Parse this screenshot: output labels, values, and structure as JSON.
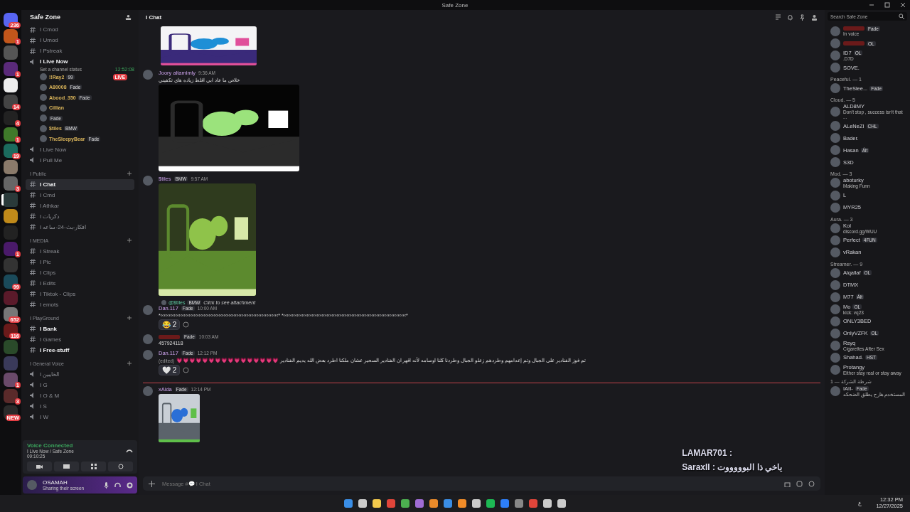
{
  "window": {
    "title": "Safe Zone"
  },
  "servers": [
    {
      "badge": "236",
      "selected": false
    },
    {
      "badge": "1",
      "selected": false
    },
    {
      "selected": false
    },
    {
      "badge": "1",
      "selected": false
    },
    {
      "selected": false
    },
    {
      "badge": "14",
      "selected": false
    },
    {
      "badge": "4",
      "selected": false
    },
    {
      "badge": "1",
      "selected": false
    },
    {
      "badge": "19",
      "selected": false
    },
    {
      "selected": false
    },
    {
      "badge": "3",
      "selected": false
    },
    {
      "selected": true
    },
    {
      "selected": false
    },
    {
      "selected": false
    },
    {
      "badge": "1",
      "selected": false
    },
    {
      "selected": false
    },
    {
      "badge": "99",
      "selected": false
    },
    {
      "selected": false
    },
    {
      "badge": "652",
      "selected": false
    },
    {
      "badge": "116",
      "selected": false
    },
    {
      "selected": false
    },
    {
      "selected": false
    },
    {
      "badge": "1",
      "selected": false
    },
    {
      "badge": "3",
      "selected": false
    },
    {
      "badge": "NEW",
      "selected": false
    }
  ],
  "sidebar": {
    "server_name": "Safe Zone",
    "channels": [
      {
        "kind": "text",
        "name": "I Cmod",
        "selected": false,
        "unread": false
      },
      {
        "kind": "text",
        "name": "I Umod",
        "selected": false,
        "unread": false
      },
      {
        "kind": "text",
        "name": "I Pstreak",
        "selected": false,
        "unread": false
      },
      {
        "kind": "voice",
        "name": "I Live Now",
        "selected": false,
        "unread": true,
        "timer": "12:52:08",
        "status": "Set a channel status",
        "users": [
          {
            "name": "!!Ray2",
            "tag": "99",
            "live": "LIVE"
          },
          {
            "name": "A80008",
            "tag": "Fade"
          },
          {
            "name": "Abood_350",
            "tag": "Fade"
          },
          {
            "name": "Cillian"
          },
          {
            "tag": "Fade"
          },
          {
            "name": "$tiles",
            "tag": "BMW"
          },
          {
            "name": "TheSleepyBear",
            "tag": "Fade"
          }
        ]
      },
      {
        "kind": "voice",
        "name": "I Live Now",
        "selected": false,
        "unread": false
      },
      {
        "kind": "voice",
        "name": "I Pull Me",
        "selected": false,
        "unread": false
      },
      {
        "kind": "category",
        "name": "I Public"
      },
      {
        "kind": "text",
        "name": "I Chat",
        "selected": true,
        "unread": true
      },
      {
        "kind": "text",
        "name": "I Cmd",
        "selected": false,
        "unread": false
      },
      {
        "kind": "text",
        "name": "I Athkar",
        "selected": false,
        "unread": false
      },
      {
        "kind": "text",
        "name": "I ذكريات",
        "selected": false,
        "unread": false
      },
      {
        "kind": "text",
        "name": "I افكار-بث-24-ساعه",
        "selected": false,
        "unread": false
      },
      {
        "kind": "category",
        "name": "I MEDIA"
      },
      {
        "kind": "text",
        "name": "I Streak",
        "selected": false,
        "unread": false
      },
      {
        "kind": "text",
        "name": "I Pic",
        "selected": false,
        "unread": false
      },
      {
        "kind": "text",
        "name": "I Clips",
        "selected": false,
        "unread": false
      },
      {
        "kind": "text",
        "name": "I Edits",
        "selected": false,
        "unread": false
      },
      {
        "kind": "text",
        "name": "I Tiktok - Clips",
        "selected": false,
        "unread": false
      },
      {
        "kind": "text",
        "name": "I emots",
        "selected": false,
        "unread": false
      },
      {
        "kind": "category",
        "name": "I PlayGround"
      },
      {
        "kind": "text",
        "name": "I Bank",
        "selected": false,
        "unread": true
      },
      {
        "kind": "text",
        "name": "I Games",
        "selected": false,
        "unread": false
      },
      {
        "kind": "text",
        "name": "I Free-stuff",
        "selected": false,
        "unread": true
      },
      {
        "kind": "category",
        "name": "I General Voice"
      },
      {
        "kind": "voice",
        "name": "I الخايبين",
        "selected": false,
        "unread": false
      },
      {
        "kind": "voice",
        "name": "I G",
        "selected": false,
        "unread": false
      },
      {
        "kind": "voice",
        "name": "I O & M",
        "selected": false,
        "unread": false
      },
      {
        "kind": "voice",
        "name": "I S",
        "selected": false,
        "unread": false
      },
      {
        "kind": "voice",
        "name": "I W",
        "selected": false,
        "unread": false
      }
    ]
  },
  "voice_panel": {
    "title": "Voice Connected",
    "channel": "I Live Now / Safe Zone",
    "elapsed": "09:10:25"
  },
  "user_panel": {
    "name": "OSAMAH",
    "status": "Sharing their screen"
  },
  "chat": {
    "channel": "I Chat",
    "search": {
      "placeholder": "Search Safe Zone"
    },
    "messages": [
      {
        "new_divider": false
      },
      {
        "author": "Joory altamimly",
        "time": "9:36 AM",
        "text": "خلاص ما عاد ابي اقلط زياده هاي تكفيني",
        "new_divider": false
      },
      {
        "author": "$tiles",
        "tag": "BMW",
        "time": "9:57 AM",
        "new_divider": false
      },
      {
        "reply": {
          "author": "@$tiles",
          "tag": "BMW",
          "text": "Click to see attachment"
        },
        "author": "Dan.117",
        "tag": "Fade",
        "time": "10:00 AM",
        "text": "*‹‹‹‹‹‹‹‹‹‹‹‹‹‹‹‹‹‹‹‹‹‹‹‹‹‹‹‹‹‹‹‹‹‹‹‹‹‹‹‹‹‹‹‹‹‹‹‹‹‹‹‹‹‹‹‹‹‹‹‹‹‹‹‹‹‹‹‹‹‹‹* *‹‹‹‹‹‹‹‹‹‹‹‹‹‹‹‹‹‹‹‹‹‹‹‹‹‹‹‹‹‹‹‹‹‹‹‹‹‹‹‹‹‹‹‹‹‹‹‹‹‹‹‹‹‹‹‹‹‹‹‹‹‹‹‹‹‹‹‹‹‹‹‹‹‹*",
        "reactions": [
          {
            "emoji": "😂",
            "count": "2"
          }
        ],
        "new_divider": false
      },
      {
        "tag": "Fade",
        "time": "10:03 AM",
        "text": "457924118",
        "new_divider": false
      },
      {
        "author": "Dan.117",
        "tag": "Fade",
        "time": "12:12 PM",
        "edited": "(edited)",
        "text": "💗💗💗💗💗💗💗💗💗💗💗💗💗💗💗💗 تم فوز الفنادير على الجبال وتم إعدامهم وطردهم زعلو الجبال وطردنا كلنا اوسامه لأنه اقهر ان الفنادير السحير عشان ملكنا اطرد بعض الله يديم الفنادير",
        "reactions": [
          {
            "emoji": "🤍",
            "count": "2"
          }
        ],
        "new_divider": false
      },
      {
        "author": "xAida",
        "tag": "Fade",
        "time": "12:14 PM",
        "new_divider": true
      }
    ],
    "overlay": [
      "LAMAR701 :",
      "SaraxII : ياخي ذا البوووووت"
    ],
    "composer": {
      "placeholder": "Message #💬 I Chat"
    }
  },
  "members": {
    "groups": [
      {
        "members": [
          {
            "tag": "Fade",
            "status": "In voice"
          },
          {
            "tag": "OL"
          }
        ]
      },
      {
        "members": [
          {
            "name": "ID7",
            "tag": "OL",
            "status": ".D7D"
          },
          {
            "name": "SOVE."
          }
        ]
      },
      {
        "label": "Peaceful. — 1",
        "members": [
          {
            "name": "TheSlee...",
            "tag": "Fade"
          }
        ]
      },
      {
        "label": "Cloud. — 5",
        "members": [
          {
            "name": "ALD8MY",
            "status": "Don't stop , success isn't that ..."
          },
          {
            "name": "ALeNeZI",
            "tag": "CHL"
          },
          {
            "name": "Bader."
          },
          {
            "name": "Hasan",
            "tag": "Ált"
          },
          {
            "name": "S3D"
          }
        ]
      },
      {
        "label": "Mod. — 3",
        "members": [
          {
            "name": "aboturky",
            "status": "Making Funn"
          },
          {
            "name": "L"
          },
          {
            "name": "MYR25"
          }
        ]
      },
      {
        "label": "Aura. — 3",
        "members": [
          {
            "name": "Kol",
            "status": "discord.gg/WUU"
          },
          {
            "name": "Perfect",
            "tag": "4FUN"
          },
          {
            "name": "vRakan"
          }
        ]
      },
      {
        "label": "Streamer. — 9",
        "members": [
          {
            "name": "Alqallaf",
            "tag": "OL"
          },
          {
            "name": "DTMX"
          },
          {
            "name": "M77",
            "tag": "Ált"
          },
          {
            "name": "Mo",
            "tag": "OL",
            "status": "kick: vq23"
          },
          {
            "name": "ONLY3BED"
          },
          {
            "name": "OnlyVZFK",
            "tag": "OL"
          },
          {
            "name": "Rsyq",
            "status": "Cigarettes After Sex"
          },
          {
            "name": "Shahad.",
            "tag": "HST"
          },
          {
            "name": "Protangy",
            "status": "Either stay real or stay away"
          }
        ]
      },
      {
        "label": "شرطة الشركة — 1",
        "members": [
          {
            "name": "IAII-",
            "tag": "Fade",
            "status": "المستخدم هارح يطلق الضحكه"
          }
        ]
      }
    ]
  },
  "taskbar": {
    "language": "ع",
    "time": "12:32 PM",
    "date": "12/27/2025"
  }
}
